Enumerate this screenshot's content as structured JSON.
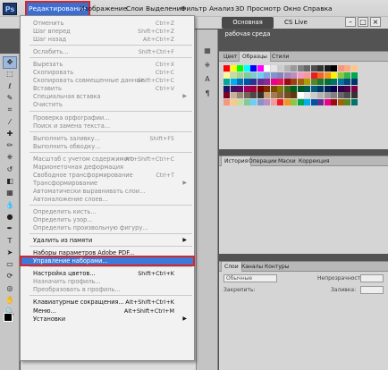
{
  "app": {
    "logo": "Ps"
  },
  "menubar": {
    "items": [
      "Редактирование",
      "Изображение",
      "Слои",
      "Выделение",
      "Фильтр",
      "Анализ",
      "3D",
      "Просмотр",
      "Окно",
      "Справка"
    ],
    "workspace": "Основная рабочая среда",
    "cslive": "CS Live",
    "window_buttons": [
      "–",
      "□",
      "×"
    ]
  },
  "edit_menu": {
    "items": [
      {
        "label": "Отменить",
        "shortcut": "Ctrl+Z",
        "disabled": true
      },
      {
        "label": "Шаг вперед",
        "shortcut": "Shift+Ctrl+Z",
        "disabled": true
      },
      {
        "label": "Шаг назад",
        "shortcut": "Alt+Ctrl+Z",
        "disabled": true
      },
      {
        "sep": true
      },
      {
        "label": "Ослабить...",
        "shortcut": "Shift+Ctrl+F",
        "disabled": true
      },
      {
        "sep": true
      },
      {
        "label": "Вырезать",
        "shortcut": "Ctrl+X",
        "disabled": true
      },
      {
        "label": "Скопировать",
        "shortcut": "Ctrl+C",
        "disabled": true
      },
      {
        "label": "Скопировать совмещенные данные",
        "shortcut": "Shift+Ctrl+C",
        "disabled": true
      },
      {
        "label": "Вставить",
        "shortcut": "Ctrl+V",
        "disabled": true
      },
      {
        "label": "Специальная вставка",
        "submenu": true,
        "disabled": true
      },
      {
        "label": "Очистить",
        "disabled": true
      },
      {
        "sep": true
      },
      {
        "label": "Проверка орфографии...",
        "disabled": true
      },
      {
        "label": "Поиск и замена текста...",
        "disabled": true
      },
      {
        "sep": true
      },
      {
        "label": "Выполнить заливку...",
        "shortcut": "Shift+F5",
        "disabled": true
      },
      {
        "label": "Выполнить обводку...",
        "disabled": true
      },
      {
        "sep": true
      },
      {
        "label": "Масштаб с учетом содержимого",
        "shortcut": "Alt+Shift+Ctrl+C",
        "disabled": true
      },
      {
        "label": "Марионеточная деформация",
        "disabled": true
      },
      {
        "label": "Свободное трансформирование",
        "shortcut": "Ctrl+T",
        "disabled": true
      },
      {
        "label": "Трансформирование",
        "submenu": true,
        "disabled": true
      },
      {
        "label": "Автоматически выравнивать слои...",
        "disabled": true
      },
      {
        "label": "Автоналожение слоев...",
        "disabled": true
      },
      {
        "sep": true
      },
      {
        "label": "Определить кисть...",
        "disabled": true
      },
      {
        "label": "Определить узор...",
        "disabled": true
      },
      {
        "label": "Определить произвольную фигуру...",
        "disabled": true
      },
      {
        "sep": true
      },
      {
        "label": "Удалить из памяти",
        "submenu": true,
        "disabled": false
      },
      {
        "sep": true
      },
      {
        "label": "Наборы параметров Adobe PDF...",
        "disabled": false
      },
      {
        "label": "Управление наборами...",
        "disabled": false,
        "highlighted": true
      },
      {
        "sep": true
      },
      {
        "label": "Настройка цветов...",
        "shortcut": "Shift+Ctrl+K",
        "disabled": false
      },
      {
        "label": "Назначить профиль...",
        "disabled": true
      },
      {
        "label": "Преобразовать в профиль...",
        "disabled": true
      },
      {
        "sep": true
      },
      {
        "label": "Клавиатурные сокращения...",
        "shortcut": "Alt+Shift+Ctrl+K",
        "disabled": false
      },
      {
        "label": "Меню...",
        "shortcut": "Alt+Shift+Ctrl+M",
        "disabled": false
      },
      {
        "label": "Установки",
        "submenu": true,
        "disabled": false
      }
    ]
  },
  "panels": {
    "swatches_tabs": [
      "Цвет",
      "Образцы",
      "Стили"
    ],
    "history_tabs": [
      "История",
      "Операции",
      "Маски",
      "Коррекция"
    ],
    "layers_tabs": [
      "Слои",
      "Каналы",
      "Контуры"
    ],
    "layers_controls": {
      "blend_mode": "Обычные",
      "opacity_label": "Непрозрачность:",
      "lock_label": "Закрепить:",
      "fill_label": "Заливка:"
    }
  },
  "icons": {
    "tools": [
      "move-icon",
      "marquee-icon",
      "lasso-icon",
      "quick-select-icon",
      "crop-icon",
      "eyedropper-icon",
      "healing-icon",
      "brush-icon",
      "stamp-icon",
      "history-brush-icon",
      "eraser-icon",
      "gradient-icon",
      "blur-icon",
      "dodge-icon",
      "pen-icon",
      "type-icon",
      "path-select-icon",
      "shape-icon",
      "3d-rotate-icon",
      "3d-orbit-icon",
      "hand-icon",
      "zoom-icon"
    ],
    "tool_glyphs": [
      "✥",
      "⬚",
      "ℓ",
      "✎",
      "⌗",
      "⁄",
      "✚",
      "✏",
      "⎈",
      "↺",
      "◧",
      "▦",
      "💧",
      "●",
      "✒",
      "T",
      "➤",
      "▭",
      "⟳",
      "◎",
      "✋",
      "🔍"
    ]
  }
}
